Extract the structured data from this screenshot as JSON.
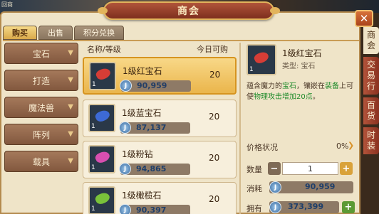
{
  "title": "商会",
  "corner_label": "回商",
  "tabs": [
    "购买",
    "出售",
    "积分兑换"
  ],
  "active_tab": 0,
  "categories": [
    "宝石",
    "打造",
    "魔法兽",
    "阵列",
    "载具"
  ],
  "list_header": {
    "name": "名称/等级",
    "stock": "今日可购"
  },
  "items": [
    {
      "name": "1级红宝石",
      "stock": "20",
      "price": "90,959",
      "qty": "1",
      "gem_color": "#d63d36",
      "selected": true
    },
    {
      "name": "1级蓝宝石",
      "stock": "20",
      "price": "87,137",
      "qty": "1",
      "gem_color": "#3d6ad6",
      "selected": false
    },
    {
      "name": "1级粉钻",
      "stock": "20",
      "price": "94,865",
      "qty": "1",
      "gem_color": "#d84fb0",
      "selected": false
    },
    {
      "name": "1级橄榄石",
      "stock": "20",
      "price": "90,397",
      "qty": "1",
      "gem_color": "#7ac23a",
      "selected": false
    }
  ],
  "detail": {
    "name": "1级红宝石",
    "type": "类型: 宝石",
    "qty": "1",
    "desc_parts": [
      {
        "text": "蕴含魔力的",
        "hl": false
      },
      {
        "text": "宝石",
        "hl": true
      },
      {
        "text": "，镶嵌在",
        "hl": false
      },
      {
        "text": "装备",
        "hl": true
      },
      {
        "text": "上可使",
        "hl": false
      },
      {
        "text": "物理攻击增加20点",
        "hl": true
      },
      {
        "text": "。",
        "hl": false
      }
    ],
    "price_status_label": "价格状况",
    "price_status_value": "0%",
    "quantity_label": "数量",
    "quantity_value": "1",
    "cost_label": "消耗",
    "cost_value": "90,959",
    "owned_label": "拥有",
    "owned_value": "373,399"
  },
  "side_tabs": [
    "商会",
    "交易行",
    "百货",
    "时装"
  ],
  "colors": {
    "gold_accent": "#d6941f",
    "highlight_text": "#1e8a2a",
    "window_bg": "#efe4c8"
  }
}
